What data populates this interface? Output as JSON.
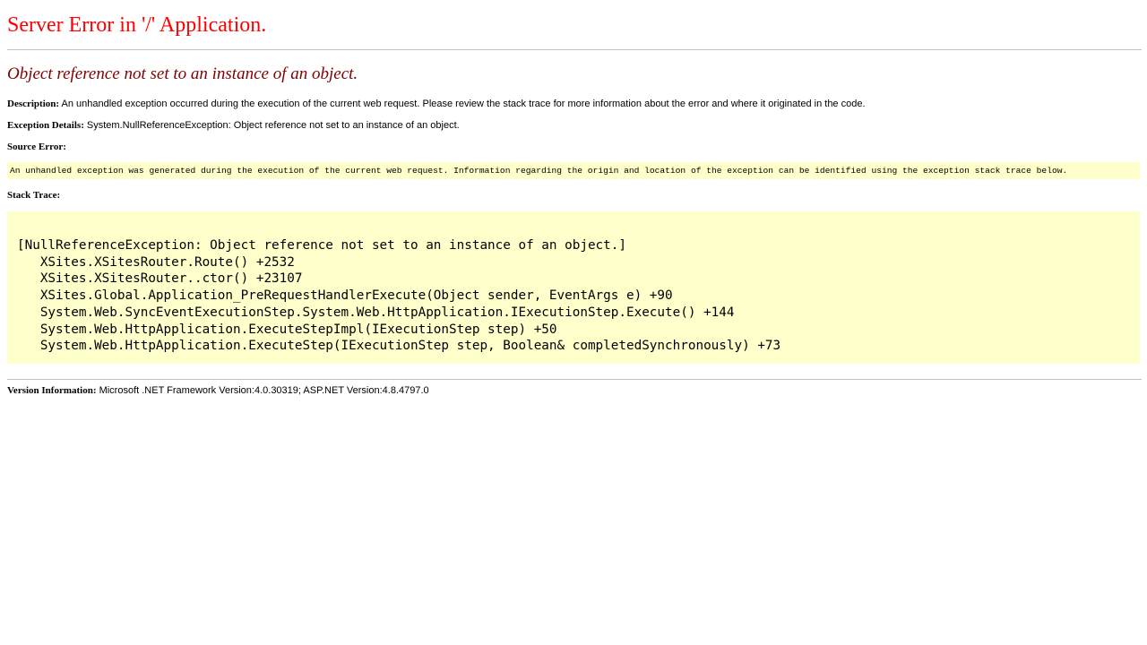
{
  "page": {
    "title": "Server Error in '/' Application.",
    "subtitle": "Object reference not set to an instance of an object."
  },
  "description": {
    "label": "Description:",
    "text": " An unhandled exception occurred during the execution of the current web request. Please review the stack trace for more information about the error and where it originated in the code."
  },
  "exception_details": {
    "label": "Exception Details:",
    "text": " System.NullReferenceException: Object reference not set to an instance of an object."
  },
  "source_error": {
    "label": "Source Error:",
    "text": "An unhandled exception was generated during the execution of the current web request. Information regarding the origin and location of the exception can be identified using the exception stack trace below."
  },
  "stack_trace": {
    "label": "Stack Trace:",
    "lines": [
      "[NullReferenceException: Object reference not set to an instance of an object.]",
      "   XSites.XSitesRouter.Route() +2532",
      "   XSites.XSitesRouter..ctor() +23107",
      "   XSites.Global.Application_PreRequestHandlerExecute(Object sender, EventArgs e) +90",
      "   System.Web.SyncEventExecutionStep.System.Web.HttpApplication.IExecutionStep.Execute() +144",
      "   System.Web.HttpApplication.ExecuteStepImpl(IExecutionStep step) +50",
      "   System.Web.HttpApplication.ExecuteStep(IExecutionStep step, Boolean& completedSynchronously) +73"
    ]
  },
  "version_info": {
    "label": "Version Information:",
    "text": " Microsoft .NET Framework Version:4.0.30319; ASP.NET Version:4.8.4797.0"
  },
  "colors": {
    "title": "#ff0000",
    "subtitle": "#800000",
    "code_background": "#ffffcc",
    "rule": "#c0c0c0"
  }
}
